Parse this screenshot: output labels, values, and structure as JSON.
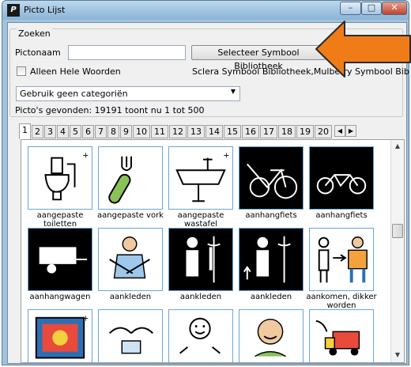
{
  "window": {
    "title": "Picto Lijst",
    "icon": "picto-app-icon"
  },
  "search": {
    "group_label": "Zoeken",
    "name_label": "Pictonaam",
    "name_value": "",
    "select_library_button": "Selecteer Symbool Bibliotheek",
    "whole_words_label": "Alleen Hele Woorden",
    "whole_words_checked": false,
    "library_list_text": "Sclera Symbool Bibliotheek,Mulberry Symbool Bibliothee",
    "category_selected": "Gebruik geen categoriën",
    "found_text": "Picto's gevonden: 19191 toont nu 1 tot 500"
  },
  "tabs": [
    "1",
    "2",
    "3",
    "4",
    "5",
    "6",
    "7",
    "8",
    "9",
    "10",
    "11",
    "12",
    "13",
    "14",
    "15",
    "16",
    "17",
    "18",
    "19",
    "20"
  ],
  "active_tab": "1",
  "pictos": [
    {
      "label": "aangepaste toiletten",
      "icon": "adapted-toilet-icon",
      "dark": false
    },
    {
      "label": "aangepaste vork",
      "icon": "adapted-fork-icon",
      "dark": false
    },
    {
      "label": "aangepaste wastafel",
      "icon": "adapted-sink-icon",
      "dark": false
    },
    {
      "label": "aanhangfiets",
      "icon": "trailer-bike-icon",
      "dark": true
    },
    {
      "label": "aanhangfiets",
      "icon": "tandem-bike-icon",
      "dark": true
    },
    {
      "label": "aanhangwagen",
      "icon": "car-trailer-icon",
      "dark": true
    },
    {
      "label": "aankleden",
      "icon": "getting-dressed-icon",
      "dark": false
    },
    {
      "label": "aankleden",
      "icon": "dressing-coat-icon",
      "dark": true
    },
    {
      "label": "aankleden",
      "icon": "dressing-arrow-icon",
      "dark": true
    },
    {
      "label": "aankomen, dikker worden",
      "icon": "gaining-weight-icon",
      "dark": false
    },
    {
      "label": "",
      "icon": "tv-screen-icon",
      "dark": false
    },
    {
      "label": "",
      "icon": "hands-paper-icon",
      "dark": false
    },
    {
      "label": "",
      "icon": "thumbs-up-person-icon",
      "dark": false
    },
    {
      "label": "",
      "icon": "happy-person-icon",
      "dark": false
    },
    {
      "label": "",
      "icon": "toy-truck-icon",
      "dark": false
    }
  ],
  "colors": {
    "title_bar": "#9fc3df",
    "cell_border": "#6ba4d8",
    "annotation_arrow": "#f07c18"
  }
}
